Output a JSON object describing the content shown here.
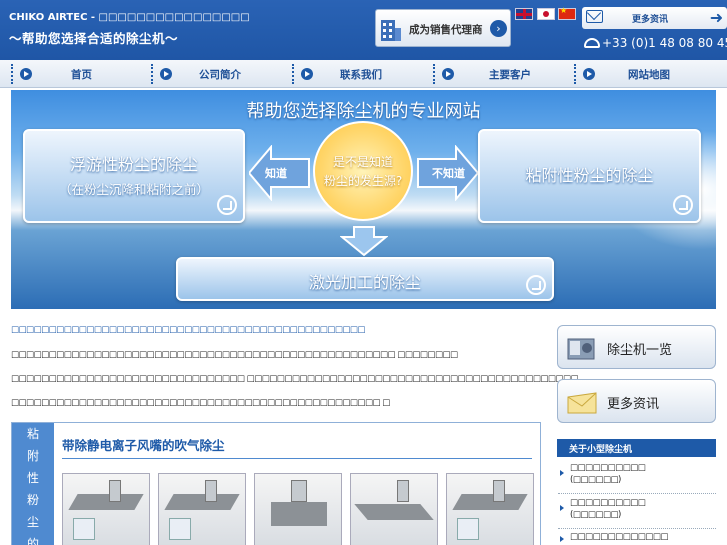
{
  "header": {
    "brand": "CHIKO AIRTEC - □□□□□□□□□□□□□□□□",
    "tagline": "～帮助您选择合适的除尘机～",
    "agent_button": "成为销售代理商",
    "more_info_button": "更多资讯",
    "phone": "+33 (0)1 48 08 80 45"
  },
  "languages": [
    "english-flag",
    "japanese-flag",
    "chinese-flag"
  ],
  "nav": [
    {
      "label": "首页"
    },
    {
      "label": "公司简介"
    },
    {
      "label": "联系我们"
    },
    {
      "label": "主要客户"
    },
    {
      "label": "网站地图"
    }
  ],
  "hero": {
    "title": "帮助您选择除尘机的专业网站",
    "left_box_line1": "浮游性粉尘的除尘",
    "left_box_line2": "（在粉尘沉降和粘附之前）",
    "right_box": "粘附性粉尘的除尘",
    "bottom_box": "激光加工的除尘",
    "center_line1": "是不是知道",
    "center_line2": "粉尘的发生源?",
    "left_arrow": "知道",
    "right_arrow": "不知道"
  },
  "content": {
    "lead": "□□□□□□□□□□□□□□□□□□□□□□□□□□□□□□□□□□□□□□□□□□□□□□□",
    "paragraphs": [
      "□□□□□□□□□□□□□□□□□□□□□□□□□□□□□□□□□□□□□□□□□□□□□□□□□□□ □□□□□□□□",
      "□□□□□□□□□□□□□□□□□□□□□□□□□□□□□□□ □□□□□□□□□□□□□□□□□□□□□□□□□□□□□□□□□□□□□□□□□□□□",
      "□□□□□□□□□□□□□□□□□□□□□□□□□□□□□□□□□□□□□□□□□□□□□□□□□ □"
    ]
  },
  "product": {
    "vertical_tab": [
      "粘",
      "附",
      "性",
      "粉",
      "尘",
      "的"
    ],
    "title": "带除静电离子风嘴的吹气除尘"
  },
  "sidebar": {
    "buttons": [
      {
        "label": "除尘机一览",
        "icon": "dust-collector-icon"
      },
      {
        "label": "更多资讯",
        "icon": "envelope-icon"
      }
    ],
    "section_title": "关于小型除尘机",
    "links": [
      {
        "line1": "□□□□□□□□□□",
        "line2": "(□□□□□□)"
      },
      {
        "line1": "□□□□□□□□□□",
        "line2": "(□□□□□□)"
      },
      {
        "line1": "□□□□□□□□□□□□□",
        "line2": ""
      }
    ]
  },
  "colors": {
    "primary": "#1e5aa8",
    "header": "#2a63b5",
    "accent_circle": "#ffd66b"
  }
}
